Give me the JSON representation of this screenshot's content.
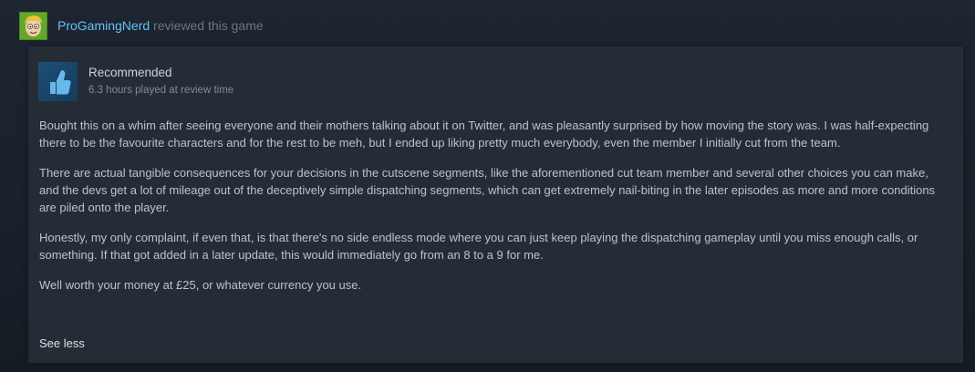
{
  "header": {
    "username": "ProGamingNerd",
    "action_text": " reviewed this game"
  },
  "review": {
    "verdict": "Recommended",
    "playtime": "6.3 hours played at review time",
    "paragraphs": [
      "Bought this on a whim after seeing everyone and their mothers talking about it on Twitter, and was pleasantly surprised by how moving the story was. I was half-expecting there to be the favourite characters and for the rest to be meh, but I ended up liking pretty much everybody, even the member I initially cut from the team.",
      "There are actual tangible consequences for your decisions in the cutscene segments, like the aforementioned cut team member and several other choices you can make, and the devs get a lot of mileage out of the deceptively simple dispatching segments, which can get extremely nail-biting in the later episodes as more and more conditions are piled onto the player.",
      "Honestly, my only complaint, if even that, is that there's no side endless mode where you can just keep playing the dispatching gameplay until you miss enough calls, or something. If that got added in a later update, this would immediately go from an 8 to a 9 for me.",
      "Well worth your money at £25, or whatever currency you use."
    ],
    "see_less_label": "See less"
  },
  "icons": {
    "avatar": "cartoon-face-avatar",
    "verdict": "thumbs-up-icon"
  },
  "colors": {
    "username": "#66c0f4",
    "thumb_bg": "#1f4f78",
    "card_bg": "#262c36"
  }
}
